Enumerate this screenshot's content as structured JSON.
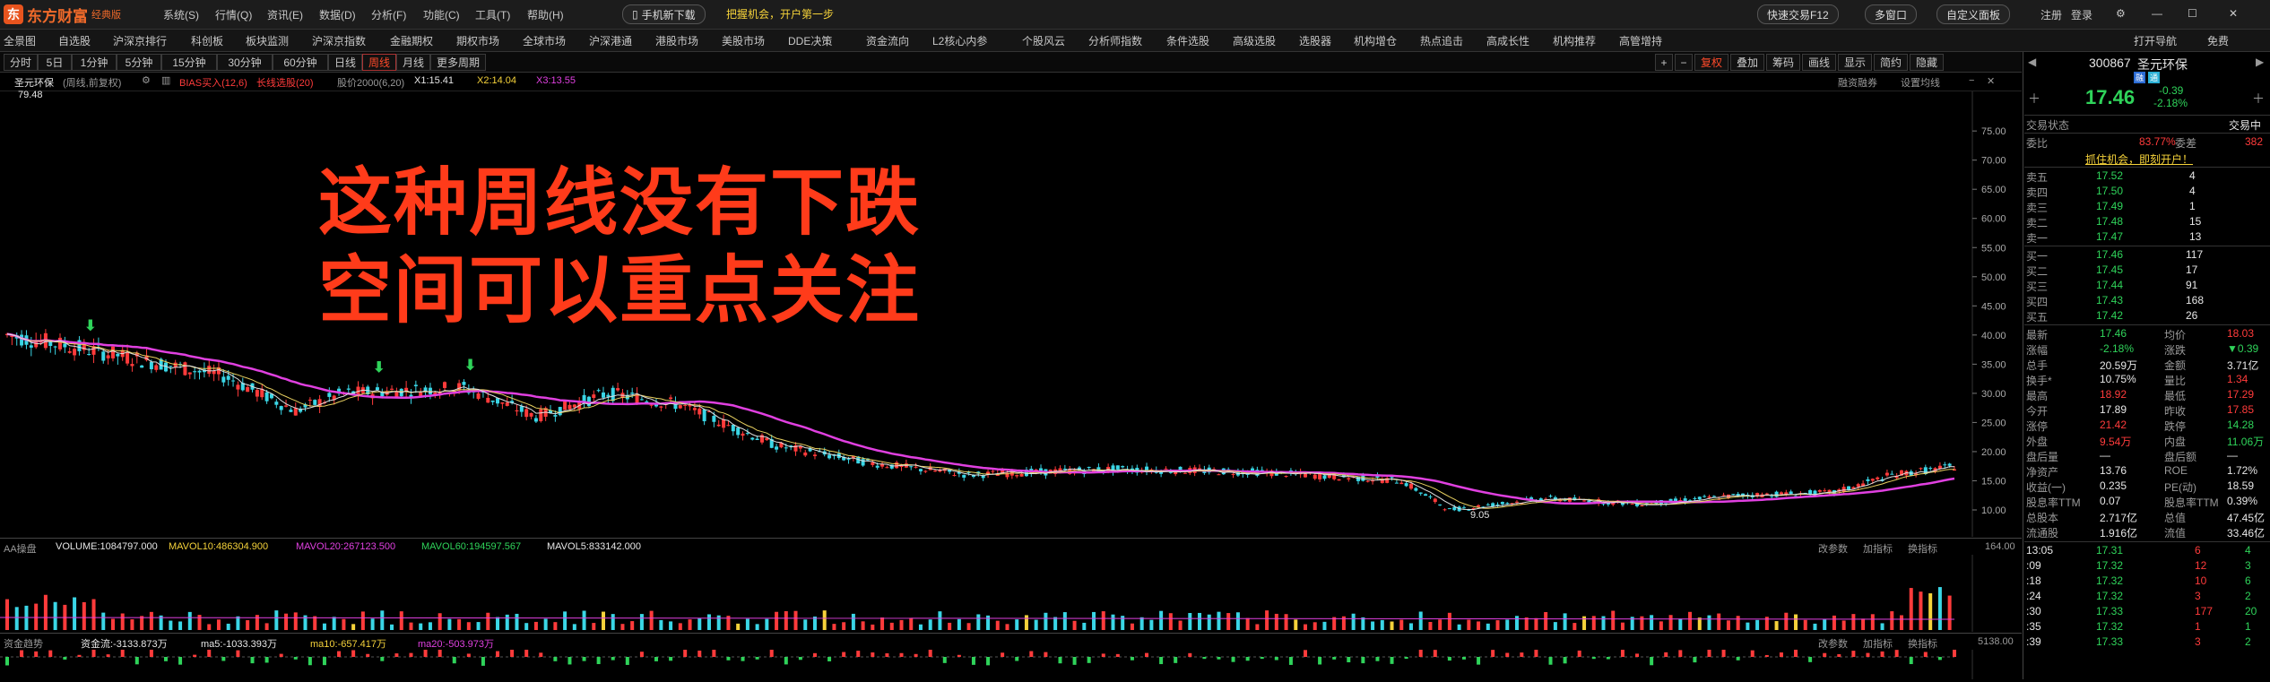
{
  "app": {
    "brand": "东方财富",
    "edition": "经典版"
  },
  "menu": [
    "系统(S)",
    "行情(Q)",
    "资讯(E)",
    "数据(D)",
    "分析(F)",
    "功能(C)",
    "工具(T)",
    "帮助(H)"
  ],
  "promo": {
    "mobile": "手机新下载",
    "chance": "把握机会，开户第一步"
  },
  "titlebar_right": {
    "quick_trade": "快速交易F12",
    "multi_window": "多窗口",
    "custom_panel": "自定义面板",
    "login": "注册",
    "logon": "登录"
  },
  "nav": [
    "全景图",
    "自选股",
    "沪深京排行",
    "科创板",
    "板块监测",
    "沪深京指数",
    "金融期权",
    "期权市场",
    "全球市场",
    "沪深港通",
    "港股市场",
    "美股市场",
    "DDE决策",
    "资金流向",
    "L2核心内参",
    "个股风云",
    "分析师指数",
    "条件选股",
    "高级选股",
    "选股器",
    "机构增仓",
    "热点追击",
    "高成长性",
    "机构推荐",
    "高管增持"
  ],
  "nav_right": {
    "open_nav": "打开导航",
    "free": "免费"
  },
  "periods": [
    "分时",
    "5日",
    "1分钟",
    "5分钟",
    "15分钟",
    "30分钟",
    "60分钟",
    "日线",
    "周线",
    "月线",
    "更多周期"
  ],
  "active_period": "周线",
  "toolbar_right": [
    "+",
    "−",
    "复权",
    "叠加",
    "筹码",
    "画线",
    "显示",
    "简约",
    "隐藏"
  ],
  "infobar": {
    "stock": "圣元环保",
    "mode": "(周线,前复权)",
    "bias": "BIAS买入(12,6)",
    "ema": "长线选股(20)",
    "ma2000": "股价2000(6,20)",
    "x1": "X1:15.41",
    "x2": "X2:14.04",
    "x3": "X3:13.55",
    "r1": "融资融券",
    "r2": "设置均线"
  },
  "y_axis": [
    "75.00",
    "70.00",
    "65.00",
    "60.00",
    "55.00",
    "50.00",
    "45.00",
    "40.00",
    "35.00",
    "30.00",
    "25.00",
    "20.00",
    "15.00",
    "10.00"
  ],
  "price_marks": {
    "high": "79.48",
    "low": "9.05"
  },
  "overlay_text": [
    "这种周线没有下跌",
    "空间可以重点关注"
  ],
  "volume": {
    "title": "AA操盘",
    "volume": "VOLUME:1084797.000",
    "mavol10": "MAVOL10:486304.900",
    "mavol20": "MAVOL20:267123.500",
    "mavol60": "MAVOL60:194597.567",
    "mavol5": "MAVOL5:833142.000",
    "btn_params": "改参数",
    "btn_add": "加指标",
    "btn_change": "换指标",
    "axis_top": "164.00"
  },
  "flow": {
    "title": "资金趋势",
    "main": "资金流:-3133.873万",
    "ma5": "ma5:-1033.393万",
    "ma10": "ma10:-657.417万",
    "ma20": "ma20:-503.973万",
    "btn_params": "改参数",
    "btn_add": "加指标",
    "btn_change": "换指标",
    "axis_top": "5138.00"
  },
  "quote": {
    "code": "300867",
    "name": "圣元环保",
    "tag1": "融",
    "tag2": "通",
    "price": "17.46",
    "change": "-0.39",
    "pct": "-2.18%",
    "trade_status_label": "交易状态",
    "trade_status": "交易中",
    "webi_label": "委比",
    "webi": "83.77%",
    "weicha_label": "委差",
    "weicha": "382",
    "promo": "抓住机会，即刻开户！",
    "asks": [
      [
        "卖五",
        "17.52",
        "4"
      ],
      [
        "卖四",
        "17.50",
        "4"
      ],
      [
        "卖三",
        "17.49",
        "1"
      ],
      [
        "卖二",
        "17.48",
        "15"
      ],
      [
        "卖一",
        "17.47",
        "13"
      ]
    ],
    "bids": [
      [
        "买一",
        "17.46",
        "117"
      ],
      [
        "买二",
        "17.45",
        "17"
      ],
      [
        "买三",
        "17.44",
        "91"
      ],
      [
        "买四",
        "17.43",
        "168"
      ],
      [
        "买五",
        "17.42",
        "26"
      ]
    ],
    "stats": [
      [
        "最新",
        "17.46",
        "均价",
        "18.03"
      ],
      [
        "涨幅",
        "-2.18%",
        "涨跌",
        "▼0.39"
      ],
      [
        "总手",
        "20.59万",
        "金额",
        "3.71亿"
      ],
      [
        "换手*",
        "10.75%",
        "量比",
        "1.34"
      ],
      [
        "最高",
        "18.92",
        "最低",
        "17.29"
      ],
      [
        "今开",
        "17.89",
        "昨收",
        "17.85"
      ],
      [
        "涨停",
        "21.42",
        "跌停",
        "14.28"
      ],
      [
        "外盘",
        "9.54万",
        "内盘",
        "11.06万"
      ],
      [
        "盘后量",
        "—",
        "盘后额",
        "—"
      ],
      [
        "净资产",
        "13.76",
        "ROE",
        "1.72%"
      ],
      [
        "收益(一)",
        "0.235",
        "PE(动)",
        "18.59"
      ],
      [
        "股息率TTM",
        "0.07",
        "股息率TTM",
        "0.39%"
      ],
      [
        "总股本",
        "2.717亿",
        "总值",
        "47.45亿"
      ],
      [
        "流通股",
        "1.916亿",
        "流值",
        "33.46亿"
      ]
    ],
    "ticks": [
      [
        "13:05",
        "17.31",
        "6",
        "4"
      ],
      [
        ":09",
        "17.32",
        "12",
        "3"
      ],
      [
        ":18",
        "17.32",
        "10",
        "6"
      ],
      [
        ":24",
        "17.32",
        "3",
        "2"
      ],
      [
        ":30",
        "17.33",
        "177",
        "20"
      ],
      [
        ":35",
        "17.32",
        "1",
        "1"
      ],
      [
        ":39",
        "17.33",
        "3",
        "2"
      ]
    ]
  },
  "colors": {
    "up": "#ff3b3b",
    "down": "#2fd35a",
    "ma_magenta": "#e040e0",
    "ma_yellow": "#e8d060",
    "ma_white": "#e0e0e0",
    "overlay": "#ff3b1a"
  }
}
